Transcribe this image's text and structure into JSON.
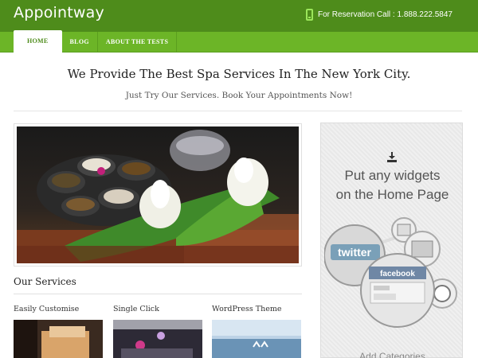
{
  "header": {
    "logo": "Appointway",
    "reservation": "For Reservation Call : 1.888.222.5847"
  },
  "nav": {
    "items": [
      {
        "label": "HOME"
      },
      {
        "label": "BLOG"
      },
      {
        "label": "ABOUT THE TESTS"
      }
    ]
  },
  "intro": {
    "headline": "We Provide The Best Spa Services In The New York City.",
    "subline": "Just Try Our Services. Book Your Appointments Now!"
  },
  "services": {
    "title": "Our Services",
    "items": [
      {
        "title": "Easily Customise"
      },
      {
        "title": "Single Click"
      },
      {
        "title": "WordPress Theme"
      }
    ]
  },
  "sidebar": {
    "line1": "Put any widgets",
    "line2": "on the Home Page",
    "twitter": "twitter",
    "facebook": "facebook",
    "footer": "Add Categories"
  },
  "colors": {
    "topbar": "#4e8c1b",
    "navbar": "#6cb527",
    "text": "#222222"
  }
}
